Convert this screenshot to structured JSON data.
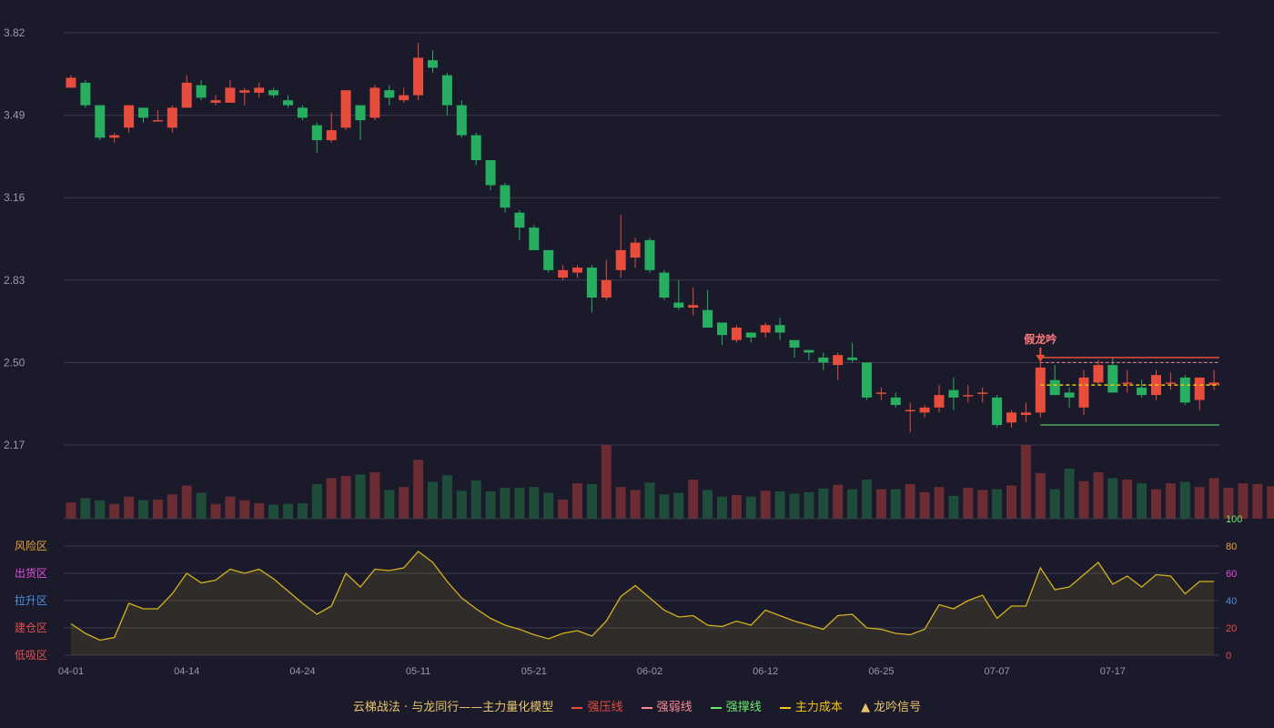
{
  "chart_data": {
    "type": "candlestick",
    "price_ticks": [
      "3.82",
      "3.49",
      "3.16",
      "2.83",
      "2.50",
      "2.17"
    ],
    "ylim": [
      2.17,
      3.82
    ],
    "x_ticks": [
      {
        "i": 0,
        "label": "04-01"
      },
      {
        "i": 8,
        "label": "04-14"
      },
      {
        "i": 16,
        "label": "04-24"
      },
      {
        "i": 24,
        "label": "05-11"
      },
      {
        "i": 32,
        "label": "05-21"
      },
      {
        "i": 40,
        "label": "06-02"
      },
      {
        "i": 48,
        "label": "06-12"
      },
      {
        "i": 56,
        "label": "06-25"
      },
      {
        "i": 64,
        "label": "07-07"
      },
      {
        "i": 72,
        "label": "07-17"
      }
    ],
    "candles": [
      [
        3.6,
        3.64,
        3.65,
        3.6
      ],
      [
        3.62,
        3.53,
        3.63,
        3.52
      ],
      [
        3.53,
        3.4,
        3.53,
        3.39
      ],
      [
        3.4,
        3.41,
        3.42,
        3.38
      ],
      [
        3.44,
        3.53,
        3.53,
        3.42
      ],
      [
        3.52,
        3.48,
        3.52,
        3.46
      ],
      [
        3.47,
        3.47,
        3.51,
        3.47
      ],
      [
        3.44,
        3.52,
        3.53,
        3.42
      ],
      [
        3.52,
        3.62,
        3.65,
        3.52
      ],
      [
        3.61,
        3.56,
        3.63,
        3.55
      ],
      [
        3.54,
        3.55,
        3.57,
        3.53
      ],
      [
        3.54,
        3.6,
        3.63,
        3.54
      ],
      [
        3.58,
        3.59,
        3.6,
        3.53
      ],
      [
        3.58,
        3.6,
        3.62,
        3.56
      ],
      [
        3.59,
        3.57,
        3.6,
        3.56
      ],
      [
        3.55,
        3.53,
        3.57,
        3.52
      ],
      [
        3.52,
        3.48,
        3.53,
        3.47
      ],
      [
        3.45,
        3.39,
        3.46,
        3.34
      ],
      [
        3.39,
        3.43,
        3.5,
        3.38
      ],
      [
        3.44,
        3.59,
        3.59,
        3.43
      ],
      [
        3.53,
        3.47,
        3.53,
        3.39
      ],
      [
        3.48,
        3.6,
        3.61,
        3.47
      ],
      [
        3.59,
        3.56,
        3.61,
        3.53
      ],
      [
        3.55,
        3.57,
        3.6,
        3.54
      ],
      [
        3.57,
        3.72,
        3.78,
        3.55
      ],
      [
        3.71,
        3.68,
        3.75,
        3.66
      ],
      [
        3.65,
        3.53,
        3.66,
        3.49
      ],
      [
        3.53,
        3.41,
        3.55,
        3.4
      ],
      [
        3.41,
        3.31,
        3.42,
        3.29
      ],
      [
        3.31,
        3.21,
        3.31,
        3.19
      ],
      [
        3.21,
        3.12,
        3.22,
        3.1
      ],
      [
        3.1,
        3.04,
        3.11,
        2.99
      ],
      [
        3.04,
        2.95,
        3.05,
        2.95
      ],
      [
        2.95,
        2.87,
        2.95,
        2.86
      ],
      [
        2.84,
        2.87,
        2.89,
        2.83
      ],
      [
        2.86,
        2.88,
        2.89,
        2.84
      ],
      [
        2.88,
        2.76,
        2.89,
        2.7
      ],
      [
        2.76,
        2.83,
        2.91,
        2.75
      ],
      [
        2.87,
        2.95,
        3.09,
        2.84
      ],
      [
        2.92,
        2.98,
        3.0,
        2.88
      ],
      [
        2.99,
        2.87,
        3.0,
        2.86
      ],
      [
        2.86,
        2.76,
        2.87,
        2.75
      ],
      [
        2.74,
        2.72,
        2.83,
        2.71
      ],
      [
        2.72,
        2.73,
        2.8,
        2.69
      ],
      [
        2.71,
        2.64,
        2.79,
        2.64
      ],
      [
        2.66,
        2.61,
        2.66,
        2.57
      ],
      [
        2.59,
        2.64,
        2.65,
        2.58
      ],
      [
        2.62,
        2.6,
        2.62,
        2.58
      ],
      [
        2.62,
        2.65,
        2.66,
        2.6
      ],
      [
        2.65,
        2.62,
        2.68,
        2.59
      ],
      [
        2.59,
        2.56,
        2.59,
        2.52
      ],
      [
        2.55,
        2.54,
        2.55,
        2.51
      ],
      [
        2.52,
        2.5,
        2.54,
        2.47
      ],
      [
        2.49,
        2.53,
        2.54,
        2.43
      ],
      [
        2.52,
        2.51,
        2.58,
        2.5
      ],
      [
        2.5,
        2.36,
        2.5,
        2.35
      ],
      [
        2.38,
        2.38,
        2.4,
        2.35
      ],
      [
        2.36,
        2.33,
        2.38,
        2.32
      ],
      [
        2.31,
        2.31,
        2.34,
        2.22
      ],
      [
        2.3,
        2.32,
        2.33,
        2.28
      ],
      [
        2.32,
        2.37,
        2.41,
        2.3
      ],
      [
        2.39,
        2.36,
        2.44,
        2.31
      ],
      [
        2.37,
        2.37,
        2.41,
        2.34
      ],
      [
        2.38,
        2.38,
        2.4,
        2.34
      ],
      [
        2.36,
        2.25,
        2.37,
        2.24
      ],
      [
        2.26,
        2.3,
        2.31,
        2.24
      ],
      [
        2.29,
        2.3,
        2.34,
        2.26
      ],
      [
        2.3,
        2.48,
        2.48,
        2.28
      ],
      [
        2.43,
        2.37,
        2.49,
        2.37
      ],
      [
        2.38,
        2.36,
        2.4,
        2.32
      ],
      [
        2.32,
        2.44,
        2.47,
        2.29
      ],
      [
        2.42,
        2.49,
        2.51,
        2.41
      ],
      [
        2.49,
        2.38,
        2.52,
        2.38
      ],
      [
        2.42,
        2.42,
        2.47,
        2.38
      ],
      [
        2.4,
        2.37,
        2.43,
        2.36
      ],
      [
        2.37,
        2.45,
        2.47,
        2.35
      ],
      [
        2.42,
        2.42,
        2.46,
        2.39
      ],
      [
        2.44,
        2.34,
        2.45,
        2.33
      ],
      [
        2.35,
        2.44,
        2.44,
        2.31
      ],
      [
        2.41,
        2.42,
        2.47,
        2.39
      ]
    ],
    "volume": [
      22,
      28,
      25,
      20,
      30,
      25,
      26,
      33,
      45,
      35,
      20,
      30,
      25,
      21,
      19,
      20,
      21,
      47,
      55,
      58,
      60,
      63,
      39,
      43,
      80,
      50,
      59,
      38,
      52,
      37,
      42,
      42,
      43,
      35,
      26,
      48,
      47,
      100,
      43,
      39,
      49,
      33,
      35,
      53,
      39,
      30,
      32,
      30,
      38,
      37,
      34,
      36,
      41,
      46,
      40,
      53,
      40,
      40,
      47,
      36,
      43,
      31,
      42,
      39,
      40,
      45,
      100,
      62,
      40,
      68,
      51,
      63,
      55,
      53,
      48,
      40,
      48,
      50,
      43,
      55,
      42,
      48,
      47,
      44,
      52,
      39
    ],
    "indicator": [
      23,
      16,
      11,
      13,
      38,
      34,
      34,
      45,
      60,
      53,
      55,
      63,
      60,
      63,
      56,
      47,
      38,
      30,
      36,
      60,
      50,
      63,
      62,
      64,
      76,
      68,
      54,
      42,
      34,
      27,
      22,
      19,
      15,
      12,
      16,
      18,
      14,
      25,
      43,
      51,
      42,
      33,
      28,
      29,
      22,
      21,
      25,
      22,
      33,
      29,
      25,
      22,
      19,
      29,
      30,
      20,
      19,
      16,
      15,
      19,
      37,
      34,
      40,
      44,
      27,
      36,
      36,
      64,
      48,
      50,
      59,
      68,
      52,
      58,
      50,
      59,
      58,
      45,
      54,
      54
    ],
    "indicator_ticks": [
      "100",
      "80",
      "60",
      "40",
      "20",
      "0"
    ],
    "zones": [
      {
        "label": "风险区",
        "color": "#e9a23b"
      },
      {
        "label": "出货区",
        "color": "#e24fe0"
      },
      {
        "label": "拉升区",
        "color": "#4f8fe2"
      },
      {
        "label": "建仓区",
        "color": "#e24f4f"
      },
      {
        "label": "低吸区",
        "color": "#e24f4f"
      }
    ],
    "signal": {
      "label": "假龙吟",
      "index": 67
    },
    "lines": {
      "strong_pressure": 2.52,
      "strong_weak": 2.5,
      "strong_support": 2.25,
      "main_cost": 2.41,
      "from_index": 67
    },
    "colors": {
      "up": "#e74c3c",
      "down": "#27ae60",
      "upvol": "#6b2c34",
      "downvol": "#1e4d3a",
      "bg": "#1a1a2b",
      "grid": "#3a3a4d",
      "axis": "#9a9aa8",
      "indicator": "#d4b21f",
      "signal": "#e74c3c"
    }
  },
  "legend": {
    "title": "云梯战法 · 与龙同行——主力量化模型",
    "strong_pressure": "强压线",
    "strong_weak": "强弱线",
    "strong_support": "强撑线",
    "main_cost": "主力成本",
    "dragon_signal": "龙吟信号"
  }
}
